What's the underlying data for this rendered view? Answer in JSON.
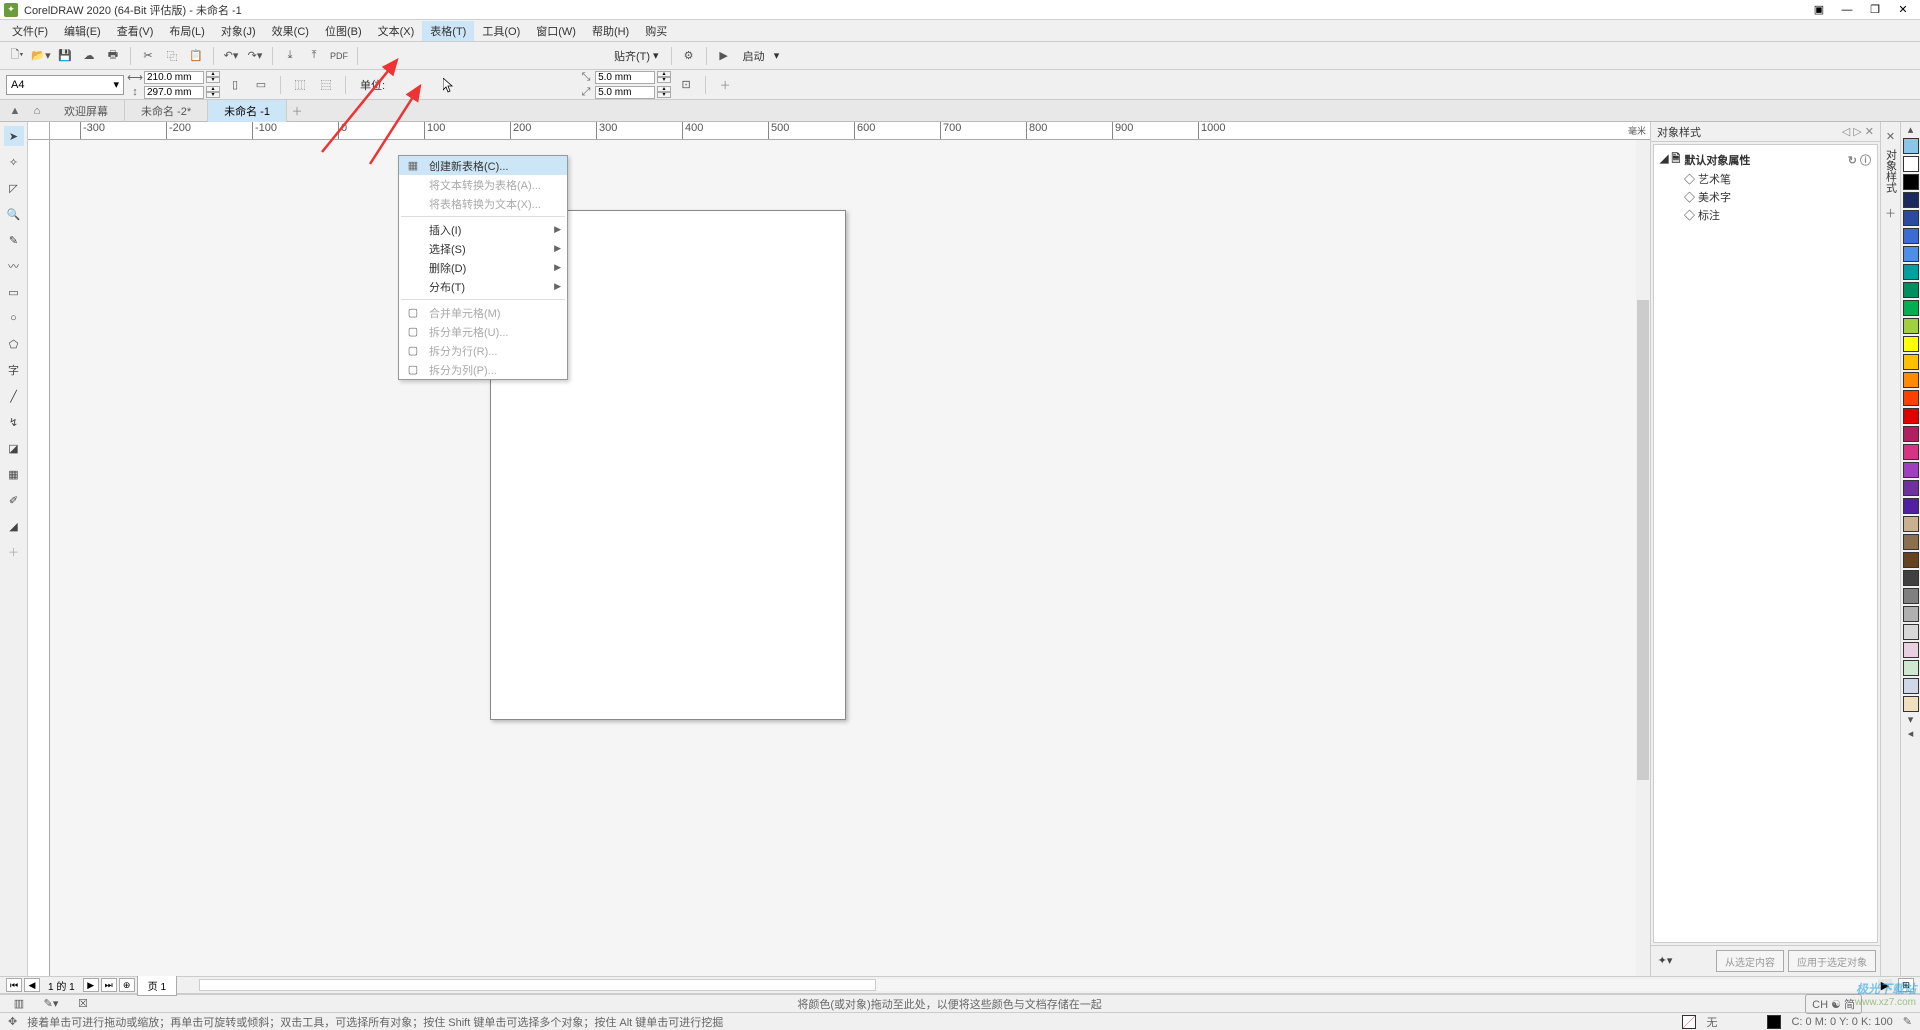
{
  "title": "CorelDRAW 2020 (64-Bit 评估版) - 未命名 -1",
  "menu": {
    "items": [
      "文件(F)",
      "编辑(E)",
      "查看(V)",
      "布局(L)",
      "对象(J)",
      "效果(C)",
      "位图(B)",
      "文本(X)",
      "表格(T)",
      "工具(O)",
      "窗口(W)",
      "帮助(H)",
      "购买"
    ],
    "active_index": 8
  },
  "toolbar": {
    "snap": "贴齐(T)",
    "launch": "启动"
  },
  "propbar": {
    "paper": "A4",
    "width": "210.0 mm",
    "height": "297.0 mm",
    "units_label": "单位:",
    "nudge1": "5.0 mm",
    "nudge2": "5.0 mm"
  },
  "tabs": {
    "items": [
      "欢迎屏幕",
      "未命名 -2*",
      "未命名 -1"
    ],
    "active_index": 2
  },
  "ruler": {
    "unit_label": "毫米",
    "h_ticks": [
      {
        "pos": 30,
        "val": "-300"
      },
      {
        "pos": 116,
        "val": "-200"
      },
      {
        "pos": 202,
        "val": "-100"
      },
      {
        "pos": 288,
        "val": "0"
      },
      {
        "pos": 374,
        "val": "100"
      },
      {
        "pos": 460,
        "val": "200"
      },
      {
        "pos": 546,
        "val": "300"
      },
      {
        "pos": 632,
        "val": "400"
      },
      {
        "pos": 718,
        "val": "500"
      },
      {
        "pos": 804,
        "val": "600"
      },
      {
        "pos": 890,
        "val": "700"
      },
      {
        "pos": 976,
        "val": "800"
      },
      {
        "pos": 1062,
        "val": "900"
      },
      {
        "pos": 1148,
        "val": "1000"
      }
    ]
  },
  "dropdown": {
    "items": [
      {
        "label": "创建新表格(C)...",
        "enabled": true,
        "hover": true,
        "icon": "grid"
      },
      {
        "label": "将文本转换为表格(A)...",
        "enabled": false,
        "icon": ""
      },
      {
        "label": "将表格转换为文本(X)...",
        "enabled": false,
        "icon": ""
      },
      {
        "sep": true
      },
      {
        "label": "插入(I)",
        "enabled": true,
        "sub": true
      },
      {
        "label": "选择(S)",
        "enabled": true,
        "sub": true
      },
      {
        "label": "删除(D)",
        "enabled": true,
        "sub": true
      },
      {
        "label": "分布(T)",
        "enabled": true,
        "sub": true
      },
      {
        "sep": true
      },
      {
        "label": "合并单元格(M)",
        "enabled": false,
        "icon": "merge"
      },
      {
        "label": "拆分单元格(U)...",
        "enabled": false,
        "icon": "split"
      },
      {
        "label": "拆分为行(R)...",
        "enabled": false,
        "icon": "row"
      },
      {
        "label": "拆分为列(P)...",
        "enabled": false,
        "icon": "col"
      }
    ]
  },
  "rpanel": {
    "title": "对象样式",
    "root": "默认对象属性",
    "children": [
      "艺术笔",
      "美术字",
      "标注"
    ],
    "btn1": "从选定内容",
    "btn2": "应用于选定对象",
    "side_tab": "对象样式"
  },
  "colors": [
    "#8bc5e8",
    "#ffffff",
    "#000000",
    "#1a2a5c",
    "#2b4aa0",
    "#3b6cd4",
    "#4d8ee8",
    "#00a0a0",
    "#009060",
    "#00b050",
    "#a0d040",
    "#ffff00",
    "#ffc000",
    "#ff8c00",
    "#ff4000",
    "#e00000",
    "#b02060",
    "#d63384",
    "#a040c0",
    "#7030a0",
    "#5020a0",
    "#c8b090",
    "#8b6f4e",
    "#654321",
    "#404040",
    "#808080",
    "#b0b0b0",
    "#d8d8d8",
    "#e8d0e0",
    "#d0e8d0",
    "#d0d8e8",
    "#f0e0c0"
  ],
  "pagenav": {
    "info": "1 的 1",
    "page_label": "页 1"
  },
  "status1": {
    "hint_drag": "将颜色(或对象)拖动至此处，以便将这些颜色与文档存储在一起",
    "lang": "CH ☯ 简"
  },
  "status2": {
    "hint": "接着单击可进行拖动或缩放；再单击可旋转或倾斜；双击工具，可选择所有对象；按住 Shift 键单击可选择多个对象；按住 Alt 键单击可进行挖掘",
    "fill_none": "无",
    "coords": "C: 0  M: 0  Y: 0  K: 100"
  },
  "watermark": {
    "line1": "极光下载站",
    "line2": "www.xz7.com"
  }
}
